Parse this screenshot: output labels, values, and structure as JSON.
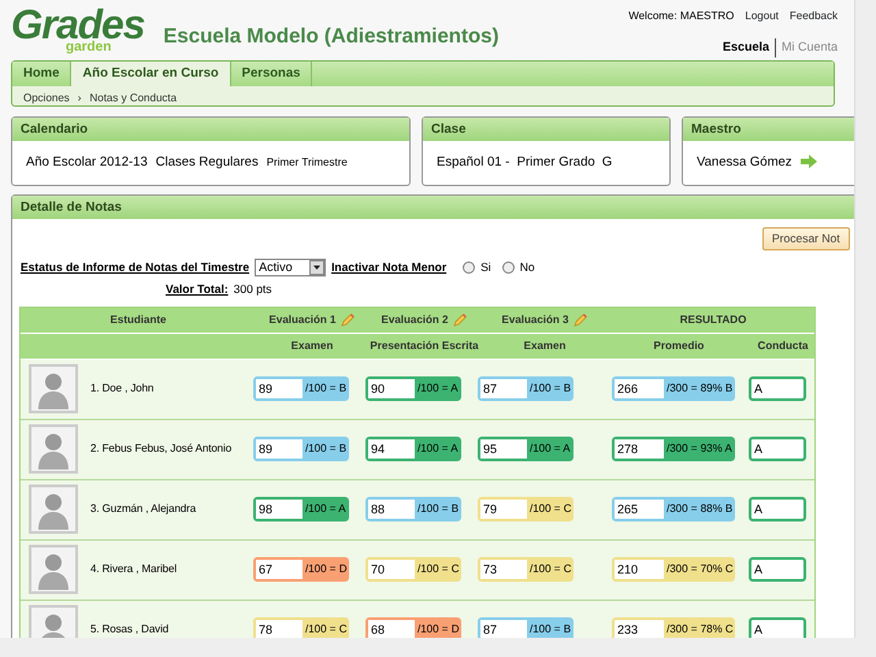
{
  "header": {
    "logo": {
      "main": "Grades",
      "sub": "garden"
    },
    "school": "Escuela Modelo (Adiestramientos)",
    "welcome": "Welcome: MAESTRO",
    "links": [
      "Logout",
      "Feedback"
    ],
    "account_links": [
      {
        "label": "Escuela",
        "selected": true
      },
      {
        "label": "Mi Cuenta",
        "selected": false
      }
    ]
  },
  "tabs": [
    {
      "label": "Home",
      "selected": false
    },
    {
      "label": "Año Escolar en Curso",
      "selected": true
    },
    {
      "label": "Personas",
      "selected": false
    }
  ],
  "breadcrumb": {
    "items": [
      "Opciones",
      "Notas y Conducta"
    ],
    "separator": "›"
  },
  "calendar": {
    "title": "Calendario",
    "year": "Año Escolar 2012-13",
    "type": "Clases Regulares",
    "term": "Primer Trimestre"
  },
  "class": {
    "title": "Clase",
    "text": "Español 01 -  Primer Grado  G"
  },
  "teacher": {
    "title": "Maestro",
    "name": "Vanessa Gómez"
  },
  "grades_panel": {
    "title": "Detalle de Notas",
    "process_button": "Procesar Not",
    "status_label": "Estatus de Informe de Notas del Timestre",
    "status_value": "Activo",
    "inactivate_label": "Inactivar Nota Menor",
    "options": [
      {
        "label": "Si",
        "selected": false
      },
      {
        "label": "No",
        "selected": false
      }
    ],
    "total_label": "Valor Total:",
    "total_value": "300 pts",
    "table": {
      "group_headers": [
        "Estudiante",
        "Evaluación 1",
        "Evaluación 2",
        "Evaluación 3",
        "RESULTADO"
      ],
      "columns": [
        "Examen",
        "Presentación Escrita",
        "Examen",
        "Promedio",
        "Conducta"
      ],
      "rows": [
        {
          "name": "1. Doe , John",
          "scores": [
            {
              "value": "89",
              "suffix": "/100 = B",
              "color": "#87ceeb"
            },
            {
              "value": "90",
              "suffix": "/100 = A",
              "color": "#3cb371"
            },
            {
              "value": "87",
              "suffix": "/100 = B",
              "color": "#87ceeb"
            }
          ],
          "average": {
            "value": "266",
            "suffix": "/300 = 89% B",
            "color": "#87ceeb"
          },
          "conduct": "A"
        },
        {
          "name": "2. Febus Febus, José Antonio",
          "scores": [
            {
              "value": "89",
              "suffix": "/100 = B",
              "color": "#87ceeb"
            },
            {
              "value": "94",
              "suffix": "/100 = A",
              "color": "#3cb371"
            },
            {
              "value": "95",
              "suffix": "/100 = A",
              "color": "#3cb371"
            }
          ],
          "average": {
            "value": "278",
            "suffix": "/300 = 93% A",
            "color": "#3cb371"
          },
          "conduct": "A"
        },
        {
          "name": "3. Guzmán , Alejandra",
          "scores": [
            {
              "value": "98",
              "suffix": "/100 = A",
              "color": "#3cb371"
            },
            {
              "value": "88",
              "suffix": "/100 = B",
              "color": "#87ceeb"
            },
            {
              "value": "79",
              "suffix": "/100 = C",
              "color": "#f0e08c"
            }
          ],
          "average": {
            "value": "265",
            "suffix": "/300 = 88% B",
            "color": "#87ceeb"
          },
          "conduct": "A"
        },
        {
          "name": "4. Rivera , Maribel",
          "scores": [
            {
              "value": "67",
              "suffix": "/100 = D",
              "color": "#f9a073"
            },
            {
              "value": "70",
              "suffix": "/100 = C",
              "color": "#f0e08c"
            },
            {
              "value": "73",
              "suffix": "/100 = C",
              "color": "#f0e08c"
            }
          ],
          "average": {
            "value": "210",
            "suffix": "/300 = 70% C",
            "color": "#f0e08c"
          },
          "conduct": "A"
        },
        {
          "name": "5. Rosas , David",
          "scores": [
            {
              "value": "78",
              "suffix": "/100 = C",
              "color": "#f0e08c"
            },
            {
              "value": "68",
              "suffix": "/100 = D",
              "color": "#f9a073"
            },
            {
              "value": "87",
              "suffix": "/100 = B",
              "color": "#87ceeb"
            }
          ],
          "average": {
            "value": "233",
            "suffix": "/300 = 78% C",
            "color": "#f0e08c"
          },
          "conduct": "A"
        }
      ]
    }
  }
}
